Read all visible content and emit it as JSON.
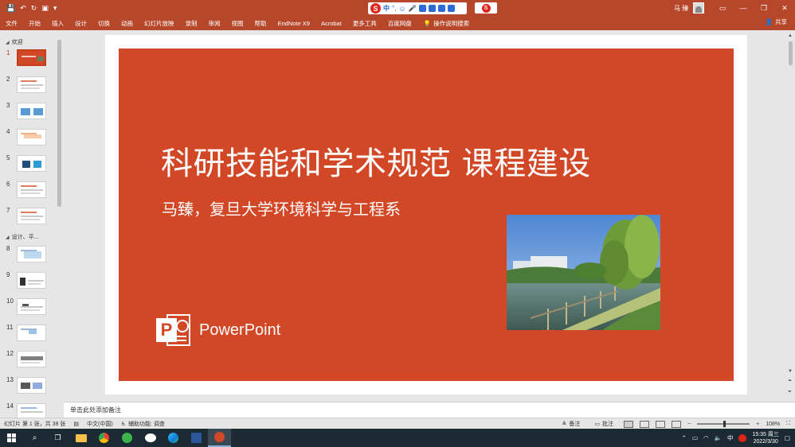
{
  "titlebar": {
    "user_name": "马 臻"
  },
  "ribbon": {
    "tabs": [
      "文件",
      "开始",
      "插入",
      "设计",
      "切换",
      "动画",
      "幻灯片放映",
      "录制",
      "审阅",
      "视图",
      "帮助",
      "EndNote X9",
      "Acrobat",
      "更多工具",
      "百度网盘"
    ],
    "tell_me": "操作说明搜索",
    "share": "共享"
  },
  "ime": {
    "mode": "中"
  },
  "thumbnails": {
    "sections": [
      "欢迎",
      "设计、平..."
    ],
    "numbers": [
      "1",
      "2",
      "3",
      "4",
      "5",
      "6",
      "7",
      "8",
      "9",
      "10",
      "11",
      "12",
      "13",
      "14"
    ],
    "active": "1"
  },
  "slide": {
    "title": "科研技能和学术规范  课程建设",
    "subtitle": "马臻，复旦大学环境科学与工程系",
    "logo_text": "PowerPoint",
    "logo_letter": "P"
  },
  "notes": {
    "placeholder": "单击此处添加备注"
  },
  "status": {
    "slide_info": "幻灯片 第 1 张，共 38 张",
    "language": "中文(中国)",
    "accessibility": "辅助功能: 调查",
    "notes_btn": "备注",
    "comments_btn": "批注",
    "zoom": "108%"
  },
  "taskbar": {
    "time": "15:35 周三",
    "date": "2022/3/30",
    "ime": "中"
  },
  "colors": {
    "accent": "#b7472a",
    "slide_bg": "#d24726"
  }
}
